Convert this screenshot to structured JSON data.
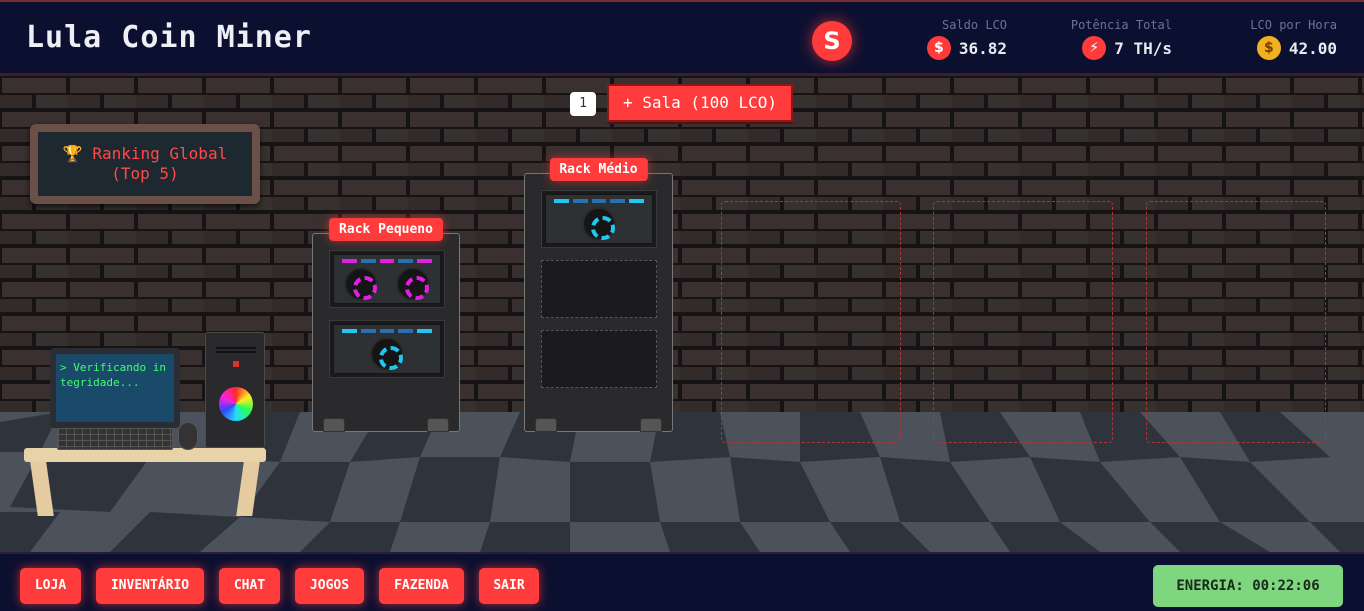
{
  "header": {
    "title": "Lula Coin Miner",
    "coin_symbol": "S",
    "stats": [
      {
        "label": "Saldo LCO",
        "icon": "dollar-icon",
        "glyph": "$",
        "value": "36.82"
      },
      {
        "label": "Potência Total",
        "icon": "lightning-icon",
        "glyph": "⚡",
        "value": "7 TH/s"
      },
      {
        "label": "LCO por Hora",
        "icon": "money-bag-icon",
        "glyph": "$",
        "value": "42.00"
      }
    ]
  },
  "room": {
    "count": "1",
    "add_label": "+ Sala (100 LCO)"
  },
  "ranking": {
    "icon": "🏆",
    "line1": "Ranking Global",
    "line2": "(Top 5)"
  },
  "racks": [
    {
      "label": "Rack Pequeno",
      "slots": [
        {
          "type": "miner",
          "fans": 2,
          "color": "#e020e0"
        },
        {
          "type": "miner",
          "fans": 1,
          "color": "#20c8f0"
        }
      ]
    },
    {
      "label": "Rack Médio",
      "slots": [
        {
          "type": "miner",
          "fans": 1,
          "color": "#20c8f0"
        },
        {
          "type": "empty"
        },
        {
          "type": "empty"
        }
      ]
    }
  ],
  "computer": {
    "screen_text": "> Verificando in tegridade..."
  },
  "footer": {
    "nav": [
      "LOJA",
      "INVENTÁRIO",
      "CHAT",
      "JOGOS",
      "FAZENDA",
      "SAIR"
    ],
    "energy_label": "ENERGIA: 00:22:06"
  },
  "colors": {
    "accent": "#ff3b3b",
    "energy": "#7ed67e",
    "header_bg": "#0c1030"
  }
}
